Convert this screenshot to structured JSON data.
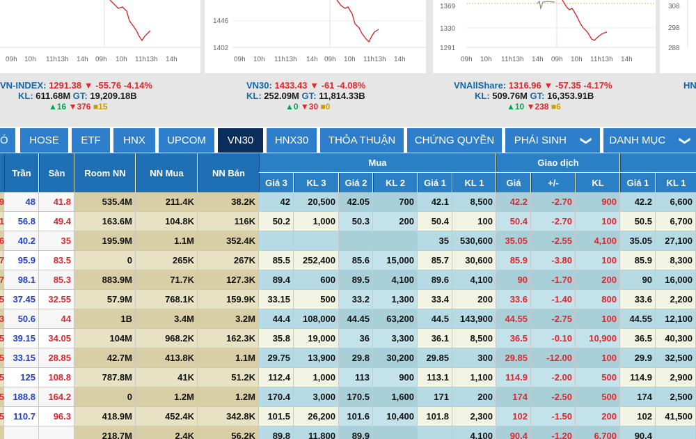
{
  "mini_charts": [
    {
      "y_ticks": [],
      "x_ticks": [
        "09h",
        "10h",
        "11h13h",
        "14h",
        "09h",
        "10h",
        "11h13h",
        "14h"
      ]
    },
    {
      "y_ticks": [
        "1446",
        "1402"
      ],
      "x_ticks": [
        "09h",
        "10h",
        "11h13h",
        "14h",
        "09h",
        "10h",
        "11h13h",
        "14h"
      ]
    },
    {
      "y_ticks": [
        "1369",
        "1330",
        "1291"
      ],
      "x_ticks": [
        "09h",
        "10h",
        "11h13h",
        "14h",
        "09h",
        "10h",
        "11h13h",
        "14h"
      ]
    },
    {
      "y_ticks": [
        "308",
        "298",
        "288"
      ],
      "x_ticks": []
    }
  ],
  "indices": [
    {
      "name": "VN-INDEX:",
      "price": "1291.38",
      "arrow": "▼",
      "change": "-55.76",
      "pct": "-4.14%",
      "kl_label": "KL:",
      "kl": "611.68M",
      "gt_label": "GT:",
      "gt": "19,209.18B",
      "up": "▲16",
      "down": "▼376",
      "ref": "■15"
    },
    {
      "name": "VN30:",
      "price": "1433.43",
      "arrow": "▼",
      "change": "-61",
      "pct": "-4.08%",
      "kl_label": "KL:",
      "kl": "252.09M",
      "gt_label": "GT:",
      "gt": "11,814.33B",
      "up": "▲0",
      "down": "▼30",
      "ref": "■0"
    },
    {
      "name": "VNAllShare:",
      "price": "1316.96",
      "arrow": "▼",
      "change": "-57.35",
      "pct": "-4.17%",
      "kl_label": "KL:",
      "kl": "509.76M",
      "gt_label": "GT:",
      "gt": "16,353.91B",
      "up": "▲10",
      "down": "▼238",
      "ref": "■6"
    },
    {
      "name": "HN",
      "partial": true
    }
  ],
  "tabs": [
    {
      "label": "Ó"
    },
    {
      "label": "HOSE"
    },
    {
      "label": "ETF"
    },
    {
      "label": "HNX"
    },
    {
      "label": "UPCOM"
    },
    {
      "label": "VN30",
      "active": true
    },
    {
      "label": "HNX30"
    },
    {
      "label": "THỎA THUẬN"
    },
    {
      "label": "CHỨNG QUYỀN"
    },
    {
      "label": "PHÁI SINH",
      "chevron": "❯"
    },
    {
      "label": "DANH MỤC",
      "chevron": "❯"
    }
  ],
  "table": {
    "headers_top": [
      "Trần",
      "Sàn",
      "Room NN",
      "NN Mua",
      "NN Bán"
    ],
    "group_mua": "Mua",
    "group_giao_dich": "Giao dịch",
    "sub_mua": [
      "Giá 3",
      "KL 3",
      "Giá 2",
      "KL 2",
      "Giá 1",
      "KL 1"
    ],
    "sub_gd": [
      "Giá",
      "+/-",
      "KL"
    ],
    "sub_ban": [
      "Giá 1",
      "KL 1"
    ],
    "rows": [
      {
        "ref": "9",
        "tran": "48",
        "san": "41.8",
        "room": "535.4M",
        "nn_mua": "211.4K",
        "nn_ban": "38.2K",
        "g3": "42",
        "k3": "20,500",
        "g2": "42.05",
        "k2": "700",
        "g1": "42.1",
        "k1": "8,500",
        "gia": "42.2",
        "chg": "-2.70",
        "kl": "900",
        "sg1": "42.2",
        "sk1": "6,600"
      },
      {
        "ref": "1",
        "tran": "56.8",
        "san": "49.4",
        "room": "163.6M",
        "nn_mua": "104.8K",
        "nn_ban": "116K",
        "g3": "50.2",
        "k3": "1,000",
        "g2": "50.3",
        "k2": "200",
        "g1": "50.4",
        "k1": "100",
        "gia": "50.4",
        "chg": "-2.70",
        "kl": "100",
        "sg1": "50.5",
        "sk1": "6,700"
      },
      {
        "ref": "6",
        "tran": "40.2",
        "san": "35",
        "room": "195.9M",
        "nn_mua": "1.1M",
        "nn_ban": "352.4K",
        "g3": "",
        "k3": "",
        "g2": "",
        "k2": "",
        "g1": "35",
        "k1": "530,600",
        "gia": "35.05",
        "chg": "-2.55",
        "kl": "4,100",
        "sg1": "35.05",
        "sk1": "27,100"
      },
      {
        "ref": "7",
        "tran": "95.9",
        "san": "83.5",
        "room": "0",
        "nn_mua": "265K",
        "nn_ban": "267K",
        "g3": "85.5",
        "k3": "252,400",
        "g2": "85.6",
        "k2": "15,000",
        "g1": "85.7",
        "k1": "30,600",
        "gia": "85.9",
        "chg": "-3.80",
        "kl": "100",
        "sg1": "85.9",
        "sk1": "8,300"
      },
      {
        "ref": "7",
        "tran": "98.1",
        "san": "85.3",
        "room": "883.9M",
        "nn_mua": "71.7K",
        "nn_ban": "127.3K",
        "g3": "89.4",
        "k3": "600",
        "g2": "89.5",
        "k2": "4,100",
        "g1": "89.6",
        "k1": "4,100",
        "gia": "90",
        "chg": "-1.70",
        "kl": "200",
        "sg1": "90",
        "sk1": "16,000"
      },
      {
        "ref": "5",
        "tran": "37.45",
        "san": "32.55",
        "room": "57.9M",
        "nn_mua": "768.1K",
        "nn_ban": "159.9K",
        "g3": "33.15",
        "k3": "500",
        "g2": "33.2",
        "k2": "1,300",
        "g1": "33.4",
        "k1": "200",
        "gia": "33.6",
        "chg": "-1.40",
        "kl": "800",
        "sg1": "33.6",
        "sk1": "2,200"
      },
      {
        "ref": "3",
        "tran": "50.6",
        "san": "44",
        "room": "1B",
        "nn_mua": "3.4M",
        "nn_ban": "3.2M",
        "g3": "44.4",
        "k3": "108,000",
        "g2": "44.45",
        "k2": "63,200",
        "g1": "44.5",
        "k1": "143,900",
        "gia": "44.55",
        "chg": "-2.75",
        "kl": "100",
        "sg1": "44.55",
        "sk1": "12,100"
      },
      {
        "ref": "5",
        "tran": "39.15",
        "san": "34.05",
        "room": "104M",
        "nn_mua": "968.2K",
        "nn_ban": "162.3K",
        "g3": "35.8",
        "k3": "19,000",
        "g2": "36",
        "k2": "3,300",
        "g1": "36.1",
        "k1": "8,500",
        "gia": "36.5",
        "chg": "-0.10",
        "kl": "10,900",
        "sg1": "36.5",
        "sk1": "40,300"
      },
      {
        "ref": "5",
        "tran": "33.15",
        "san": "28.85",
        "room": "42.7M",
        "nn_mua": "413.8K",
        "nn_ban": "1.1M",
        "g3": "29.75",
        "k3": "13,900",
        "g2": "29.8",
        "k2": "30,200",
        "g1": "29.85",
        "k1": "300",
        "gia": "29.85",
        "chg": "-12.00",
        "kl": "100",
        "sg1": "29.9",
        "sk1": "32,500"
      },
      {
        "ref": "5",
        "tran": "125",
        "san": "108.8",
        "room": "787.8M",
        "nn_mua": "41K",
        "nn_ban": "51.2K",
        "g3": "112.4",
        "k3": "1,000",
        "g2": "113",
        "k2": "900",
        "g1": "113.1",
        "k1": "1,100",
        "gia": "114.9",
        "chg": "-2.00",
        "kl": "500",
        "sg1": "114.9",
        "sk1": "2,900"
      },
      {
        "ref": "5",
        "tran": "188.8",
        "san": "164.2",
        "room": "0",
        "nn_mua": "1.2M",
        "nn_ban": "1.2M",
        "g3": "170.4",
        "k3": "3,000",
        "g2": "170.5",
        "k2": "1,600",
        "g1": "171",
        "k1": "200",
        "gia": "174",
        "chg": "-2.50",
        "kl": "500",
        "sg1": "174",
        "sk1": "2,500"
      },
      {
        "ref": "5",
        "tran": "110.7",
        "san": "96.3",
        "room": "418.9M",
        "nn_mua": "452.4K",
        "nn_ban": "342.8K",
        "g3": "101.5",
        "k3": "26,200",
        "g2": "101.6",
        "k2": "10,400",
        "g1": "101.8",
        "k1": "2,300",
        "gia": "102",
        "chg": "-1.50",
        "kl": "200",
        "sg1": "102",
        "sk1": "41,500"
      },
      {
        "ref": "",
        "tran": "",
        "san": "",
        "room": "218.7M",
        "nn_mua": "2.4K",
        "nn_ban": "56.2K",
        "g3": "89.8",
        "k3": "11,800",
        "g2": "89.9",
        "k2": "",
        "g1": "",
        "k1": "4,100",
        "gia": "90.4",
        "chg": "-1.20",
        "kl": "6,700",
        "sg1": "90.4",
        "sk1": ""
      }
    ]
  },
  "colors": {
    "red": "#e3262b",
    "blue": "#1f3fcf",
    "black": "#111111",
    "header_dark": "#1f6fb5",
    "header_light": "#2b80c5",
    "tab": "#2d7ecb",
    "tab_active": "#0b2e5c",
    "bg_room": "#d9cfa6",
    "bg_light": "#f1f4e3",
    "bg_mua": "#a9cfd9",
    "bg_mua_alt": "#b6dbe4",
    "bg_white": "#ffffff"
  }
}
